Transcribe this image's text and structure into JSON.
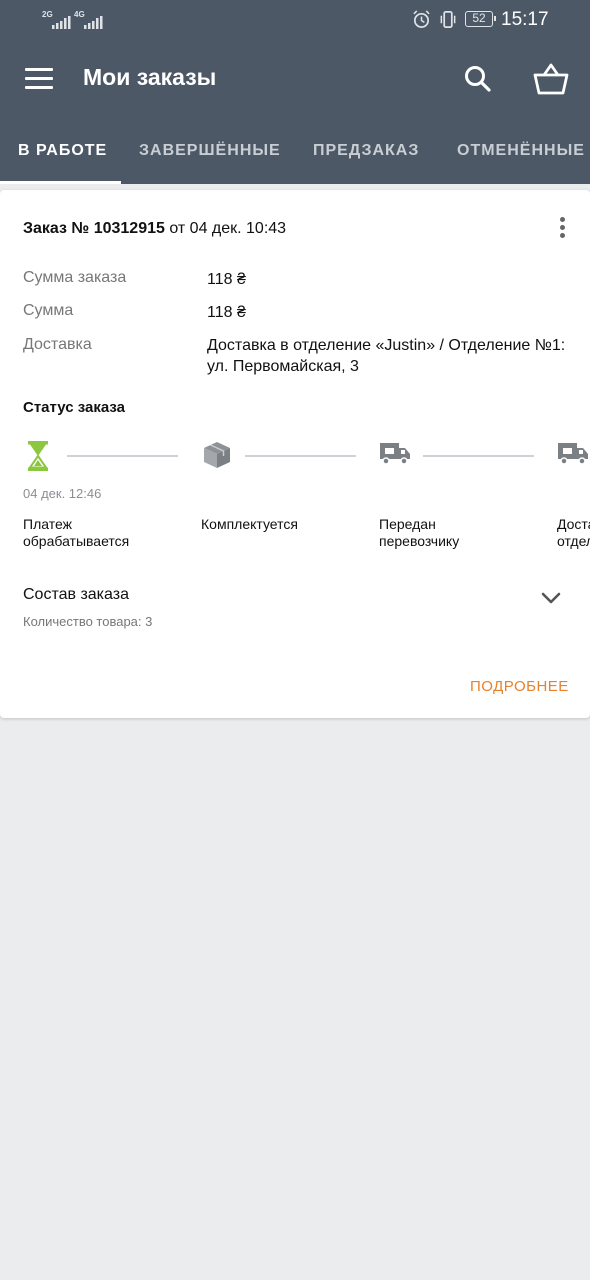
{
  "status_bar": {
    "net1": "2G",
    "net2": "4G",
    "battery": "52",
    "time": "15:17"
  },
  "app_bar": {
    "title": "Мои заказы",
    "icons": [
      "menu-icon",
      "search-icon",
      "basket-icon"
    ]
  },
  "tabs": [
    {
      "label": "В РАБОТЕ",
      "active": true
    },
    {
      "label": "ЗАВЕРШЁННЫЕ",
      "active": false
    },
    {
      "label": "ПРЕДЗАКАЗ",
      "active": false
    },
    {
      "label": "ОТМЕНЁННЫЕ",
      "active": false
    }
  ],
  "order": {
    "number_label": "Заказ № 10312915",
    "date_label": "от 04 дек. 10:43",
    "fields": [
      {
        "label": "Сумма заказа",
        "value": "118 ₴"
      },
      {
        "label": "Сумма",
        "value": "118 ₴"
      },
      {
        "label": "Доставка",
        "value": "Доставка в отделение «Justin» / Отделение №1: ул. Первомайская, 3"
      }
    ],
    "status_title": "Статус заказа",
    "steps": [
      {
        "label": "Платеж обрабатывается",
        "line1": "Платеж",
        "line2": "обрабатывается",
        "date": "04 дек. 12:46",
        "icon": "hourglass-icon",
        "active": true
      },
      {
        "label": "Комплектуется",
        "line1": "Комплектуется",
        "line2": "",
        "date": "",
        "icon": "package-icon",
        "active": false
      },
      {
        "label": "Передан перевозчику",
        "line1": "Передан",
        "line2": "перевозчику",
        "date": "",
        "icon": "delivery-truck-icon",
        "active": false
      },
      {
        "label": "Доставлено в отделение",
        "line1": "Доставлено",
        "line2": "отделение",
        "date": "",
        "icon": "delivery-truck-icon",
        "active": false
      }
    ],
    "composition_title": "Состав заказа",
    "composition_count": "Количество товара: 3",
    "details_button": "ПОДРОБНЕЕ"
  },
  "colors": {
    "header_bg": "#4d5866",
    "accent_orange": "#e7812b",
    "active_step_green": "#8dc63f",
    "page_bg": "#ebecee"
  }
}
